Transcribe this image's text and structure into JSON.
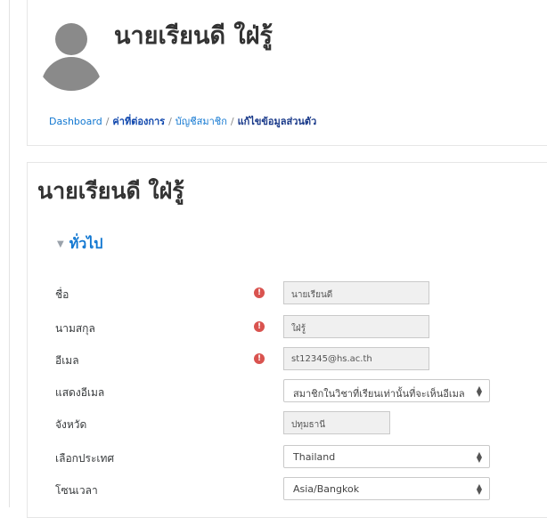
{
  "header": {
    "title": "นายเรียนดี ใฝ่รู้"
  },
  "breadcrumb": {
    "items": [
      "Dashboard",
      "ค่าที่ต่องการ",
      "บัญชีสมาชิก",
      "แก้ไขข้อมูลส่วนตัว"
    ],
    "separator": "/"
  },
  "main": {
    "user_name": "นายเรียนดี ใฝ่รู้",
    "section_label": "ทั่วไป",
    "section_caret": "▼",
    "required_mark": "!",
    "fields": {
      "first_name": {
        "label": "ชื่อ",
        "value": "นายเรียนดี"
      },
      "last_name": {
        "label": "นามสกุล",
        "value": "ใฝ่รู้"
      },
      "email": {
        "label": "อีเมล",
        "value": "st12345@hs.ac.th"
      },
      "show_email": {
        "label": "แสดงอีเมล",
        "value": "สมาชิกในวิชาที่เรียนเท่านั้นที่จะเห็นอีเมล"
      },
      "province": {
        "label": "จังหวัด",
        "value": "ปทุมธานี"
      },
      "country": {
        "label": "เลือกประเทศ",
        "value": "Thailand"
      },
      "timezone": {
        "label": "โซนเวลา",
        "value": "Asia/Bangkok"
      }
    }
  },
  "colors": {
    "link": "#1177d1",
    "required": "#d9534f",
    "avatar": "#8a8a8a"
  },
  "icons": {
    "required": "exclamation-circle-icon",
    "select_arrow": "up-down-arrows-icon",
    "avatar": "user-silhouette-icon"
  }
}
